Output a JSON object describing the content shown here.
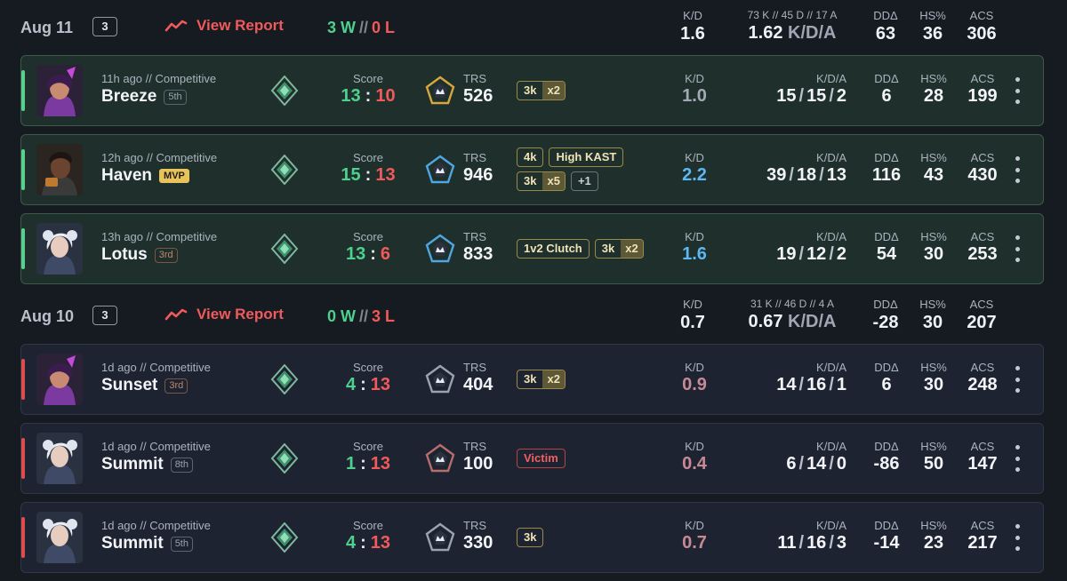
{
  "days": [
    {
      "date": "Aug 11",
      "count": "3",
      "view_report": "View Report",
      "wins": "3 W",
      "sep": "//",
      "losses": "0 L",
      "stats": {
        "kd_label": "K/D",
        "kd": "1.6",
        "kda_label": "73 K // 45 D // 17 A",
        "kda": "1.62",
        "kda_suffix": "K/D/A",
        "dd_label": "DDΔ",
        "dd": "63",
        "hs_label": "HS%",
        "hs": "36",
        "acs_label": "ACS",
        "acs": "306"
      }
    },
    {
      "date": "Aug 10",
      "count": "3",
      "view_report": "View Report",
      "wins": "0 W",
      "sep": "//",
      "losses": "3 L",
      "stats": {
        "kd_label": "K/D",
        "kd": "0.7",
        "kda_label": "31 K // 46 D // 4 A",
        "kda": "0.67",
        "kda_suffix": "K/D/A",
        "dd_label": "DDΔ",
        "dd": "-28",
        "hs_label": "HS%",
        "hs": "30",
        "acs_label": "ACS",
        "acs": "207"
      }
    }
  ],
  "labels": {
    "score": "Score",
    "trs": "TRS",
    "kd": "K/D",
    "kda": "K/D/A",
    "dd": "DDΔ",
    "hs": "HS%",
    "acs": "ACS",
    "colon": ":"
  },
  "matches": [
    {
      "result": "win",
      "time": "11h ago // Competitive",
      "map": "Breeze",
      "place": "5th",
      "us": "13",
      "them": "10",
      "trs": "526",
      "kd": "1.0",
      "k": "15",
      "d": "15",
      "a": "2",
      "dd": "6",
      "hs": "28",
      "acs": "199",
      "badges": [
        [
          {
            "text": "3k",
            "mult": "x2"
          }
        ]
      ]
    },
    {
      "result": "win",
      "time": "12h ago // Competitive",
      "map": "Haven",
      "mvp": "MVP",
      "us": "15",
      "them": "13",
      "trs": "946",
      "kd": "2.2",
      "k": "39",
      "d": "18",
      "a": "13",
      "dd": "116",
      "hs": "43",
      "acs": "430",
      "badges": [
        [
          {
            "text": "4k"
          },
          {
            "text": "High KAST"
          }
        ],
        [
          {
            "text": "3k",
            "mult": "x5"
          },
          {
            "text": "+1",
            "kind": "plain"
          }
        ]
      ]
    },
    {
      "result": "win",
      "time": "13h ago // Competitive",
      "map": "Lotus",
      "place": "3rd",
      "us": "13",
      "them": "6",
      "trs": "833",
      "kd": "1.6",
      "k": "19",
      "d": "12",
      "a": "2",
      "dd": "54",
      "hs": "30",
      "acs": "253",
      "badges": [
        [
          {
            "text": "1v2 Clutch"
          },
          {
            "text": "3k",
            "mult": "x2"
          }
        ]
      ]
    },
    {
      "result": "loss",
      "time": "1d ago // Competitive",
      "map": "Sunset",
      "place": "3rd",
      "us": "4",
      "them": "13",
      "trs": "404",
      "kd": "0.9",
      "k": "14",
      "d": "16",
      "a": "1",
      "dd": "6",
      "hs": "30",
      "acs": "248",
      "badges": [
        [
          {
            "text": "3k",
            "mult": "x2"
          }
        ]
      ]
    },
    {
      "result": "loss",
      "time": "1d ago // Competitive",
      "map": "Summit",
      "place": "8th",
      "us": "1",
      "them": "13",
      "trs": "100",
      "kd": "0.4",
      "k": "6",
      "d": "14",
      "a": "0",
      "dd": "-86",
      "hs": "50",
      "acs": "147",
      "badges": [
        [
          {
            "text": "Victim",
            "kind": "victim"
          }
        ]
      ]
    },
    {
      "result": "loss",
      "time": "1d ago // Competitive",
      "map": "Summit",
      "place": "5th",
      "us": "4",
      "them": "13",
      "trs": "330",
      "kd": "0.7",
      "k": "11",
      "d": "16",
      "a": "3",
      "dd": "-14",
      "hs": "23",
      "acs": "217",
      "badges": [
        [
          {
            "text": "3k"
          }
        ]
      ]
    }
  ],
  "colors": {
    "win": "#4fd08f",
    "loss": "#f05a5a",
    "kd_good": "#5bb8f2",
    "kd_bad": "#c78a95",
    "badge_gold": "#efe3b5"
  }
}
